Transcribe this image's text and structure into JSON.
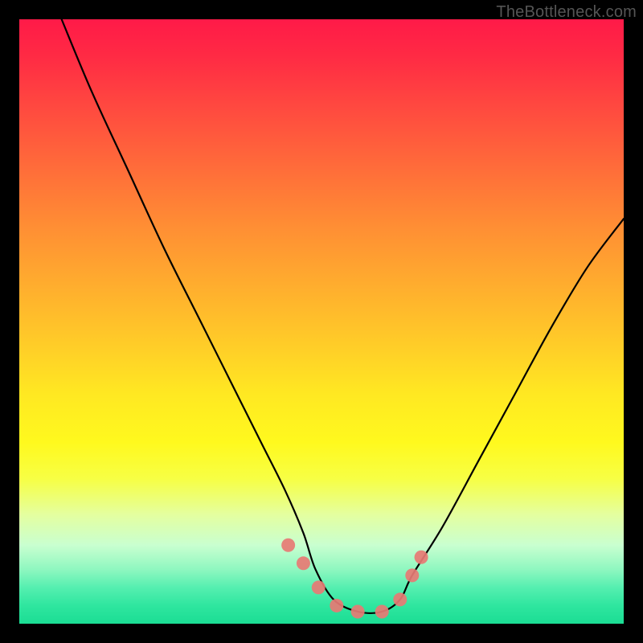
{
  "watermark": {
    "text": "TheBottleneck.com"
  },
  "chart_data": {
    "type": "line",
    "title": "",
    "xlabel": "",
    "ylabel": "",
    "xlim": [
      0,
      100
    ],
    "ylim": [
      0,
      100
    ],
    "series": [
      {
        "name": "bottleneck-curve",
        "x": [
          7,
          12,
          18,
          24,
          30,
          35,
          40,
          44,
          47,
          49,
          52,
          56,
          60,
          63,
          65,
          70,
          76,
          82,
          88,
          94,
          100
        ],
        "y": [
          100,
          88,
          75,
          62,
          50,
          40,
          30,
          22,
          15,
          9,
          4,
          2,
          2,
          4,
          8,
          16,
          27,
          38,
          49,
          59,
          67
        ]
      },
      {
        "name": "marker-dots",
        "x": [
          44.5,
          47,
          49.5,
          52.5,
          56,
          60,
          63,
          65,
          66.5
        ],
        "y": [
          13,
          10,
          6,
          3,
          2,
          2,
          4,
          8,
          11
        ]
      }
    ],
    "gradient_stops": [
      {
        "pct": 0,
        "color": "#ff1a48"
      },
      {
        "pct": 50,
        "color": "#ffcd28"
      },
      {
        "pct": 75,
        "color": "#fff91e"
      },
      {
        "pct": 100,
        "color": "#1bdd94"
      }
    ]
  }
}
